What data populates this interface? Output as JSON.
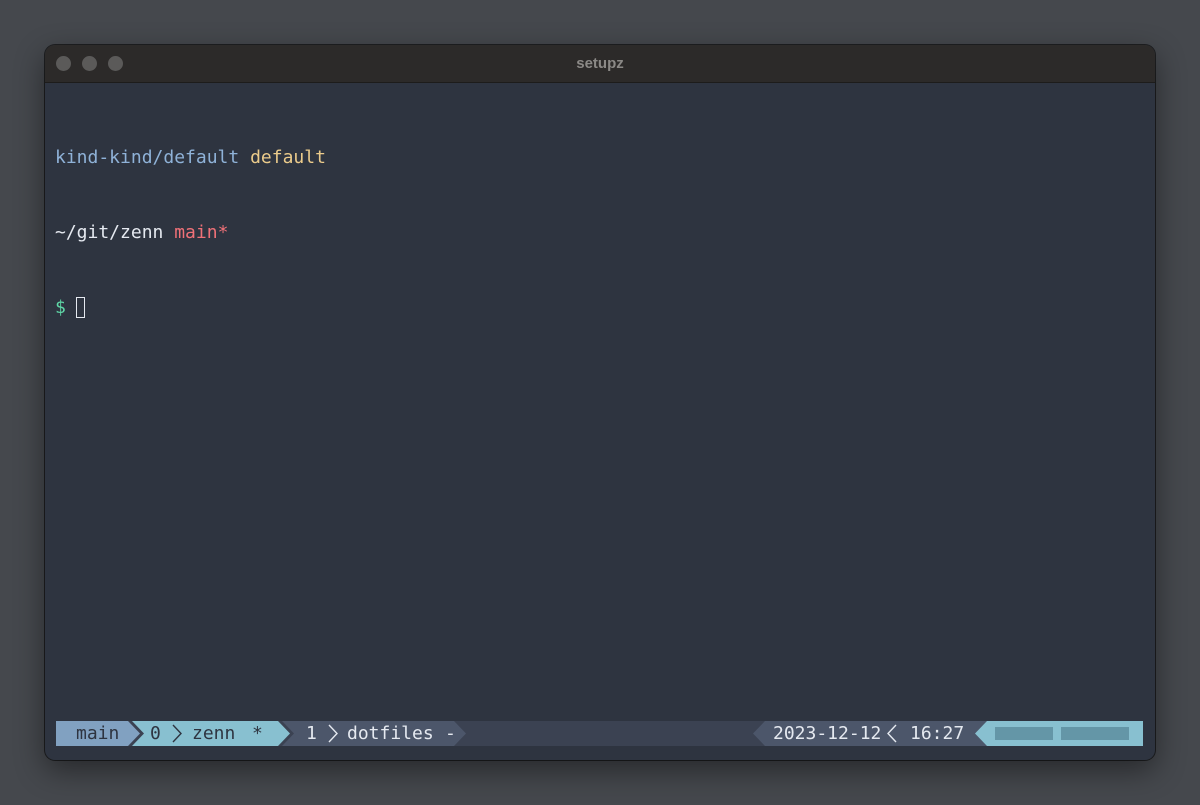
{
  "window": {
    "title": "setupz"
  },
  "terminal": {
    "kube_context": "kind-kind/default",
    "kube_namespace": "default",
    "path": "~/git/zenn",
    "git_branch": "main*",
    "prompt_symbol": "$"
  },
  "status_bar": {
    "session": "main",
    "windows": [
      {
        "index": "0",
        "name": "zenn",
        "flag": "*"
      },
      {
        "index": "1",
        "name": "dotfiles",
        "flag": "-"
      }
    ],
    "date": "2023-12-12",
    "time": "16:27",
    "hostname_obscured": true
  },
  "colors": {
    "terminal_bg": "#2e3440",
    "kube_context": "#8fb2d8",
    "kube_namespace": "#ebcb8b",
    "branch": "#f07178",
    "prompt": "#5fd7a7",
    "status_accent": "#88c0d0",
    "status_session": "#81a1c1"
  }
}
